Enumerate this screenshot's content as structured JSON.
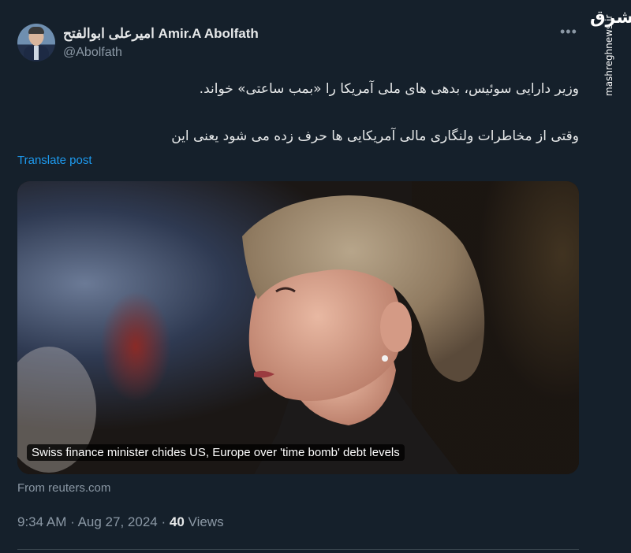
{
  "author": {
    "name": "امیرعلی ابوالفتح Amir.A Abolfath",
    "handle": "@Abolfath"
  },
  "tweet": {
    "line1": "وزیر دارایی سوئیس، بدهی های ملی آمریکا را «بمب ساعتی» خواند.",
    "line2": "وقتی از مخاطرات ولنگاری مالی آمریکایی ها حرف زده می شود یعنی این",
    "translate_label": "Translate post"
  },
  "card": {
    "caption": "Swiss finance minister chides US, Europe over 'time bomb' debt levels",
    "source": "From reuters.com"
  },
  "meta": {
    "time": "9:34 AM",
    "separator1": "·",
    "date": "Aug 27, 2024",
    "separator2": "·",
    "views_count": "40",
    "views_label": "Views"
  },
  "watermark": {
    "logo_text": "مشرق",
    "site": "mashreghnews.ir"
  },
  "icons": {
    "more": "more-dots-icon"
  }
}
